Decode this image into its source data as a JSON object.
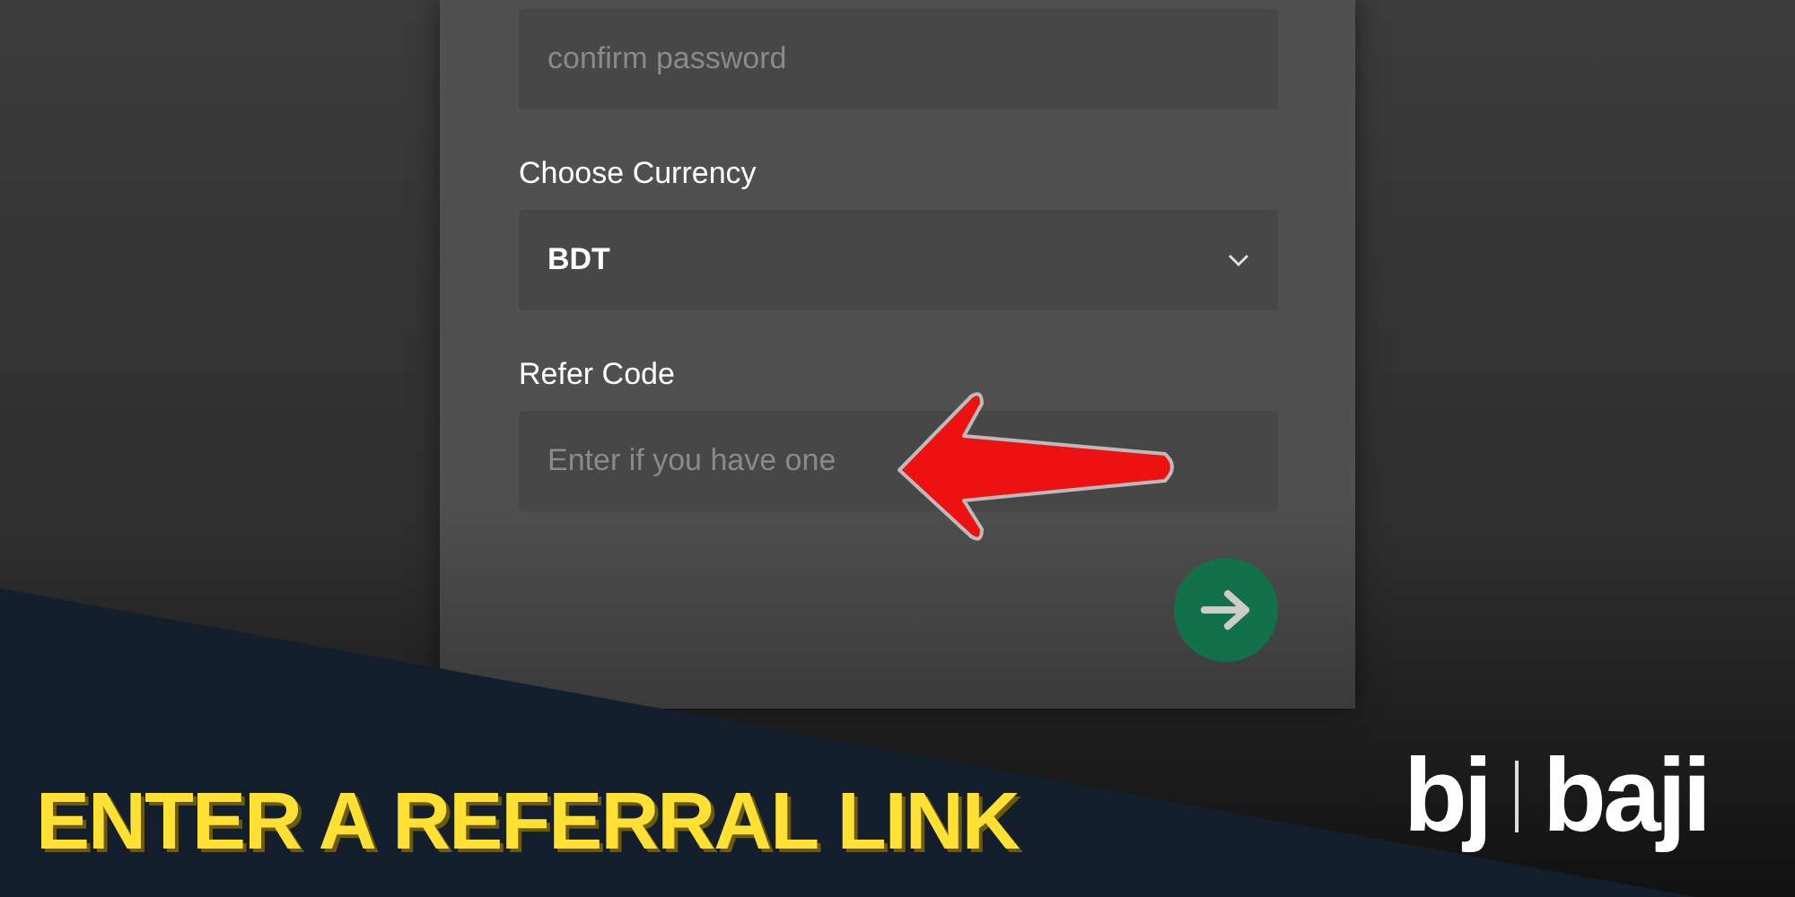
{
  "form": {
    "fields": [
      {
        "kind": "input",
        "placeholder": "confirm password"
      },
      {
        "kind": "select",
        "label": "Choose Currency",
        "value": "BDT"
      },
      {
        "kind": "input",
        "label": "Refer Code",
        "placeholder": "Enter if you have one"
      }
    ]
  },
  "banner": {
    "title": "ENTER A REFERRAL LINK",
    "logo": [
      "bj",
      "baji"
    ]
  }
}
